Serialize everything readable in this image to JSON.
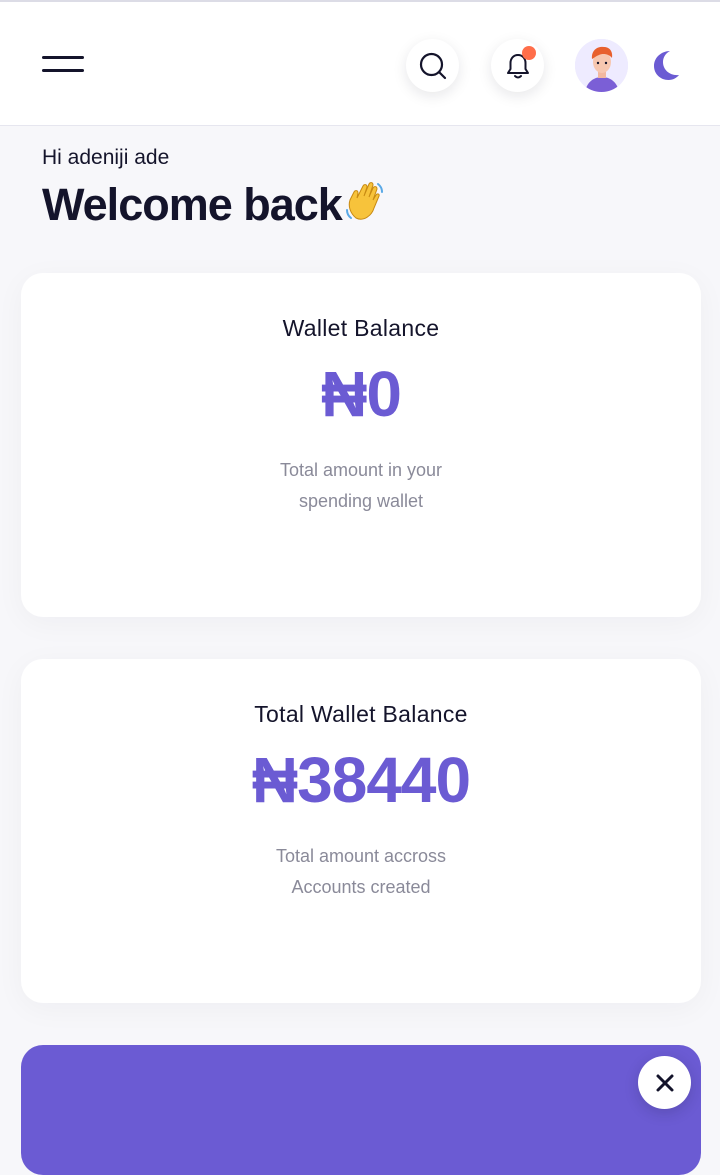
{
  "header": {
    "menu_icon": "hamburger-menu-icon",
    "search_icon": "search-icon",
    "notification_icon": "bell-icon",
    "notification_dot_color": "#ff6e4a",
    "avatar_icon": "user-avatar",
    "theme_icon": "moon-icon"
  },
  "greeting": {
    "hello": "Hi adeniji ade",
    "welcome": "Welcome back",
    "wave_icon": "waving-hand-icon"
  },
  "cards": [
    {
      "title": "Wallet Balance",
      "amount": "₦0",
      "desc_line1": "Total amount in your",
      "desc_line2": "spending wallet"
    },
    {
      "title": "Total Wallet Balance",
      "amount": "₦38440",
      "desc_line1": "Total amount accross",
      "desc_line2": "Accounts created"
    }
  ],
  "promo": {
    "close_icon": "close-icon"
  },
  "colors": {
    "accent": "#6b5bd3",
    "text": "#14142b",
    "muted": "#8a8a99"
  }
}
